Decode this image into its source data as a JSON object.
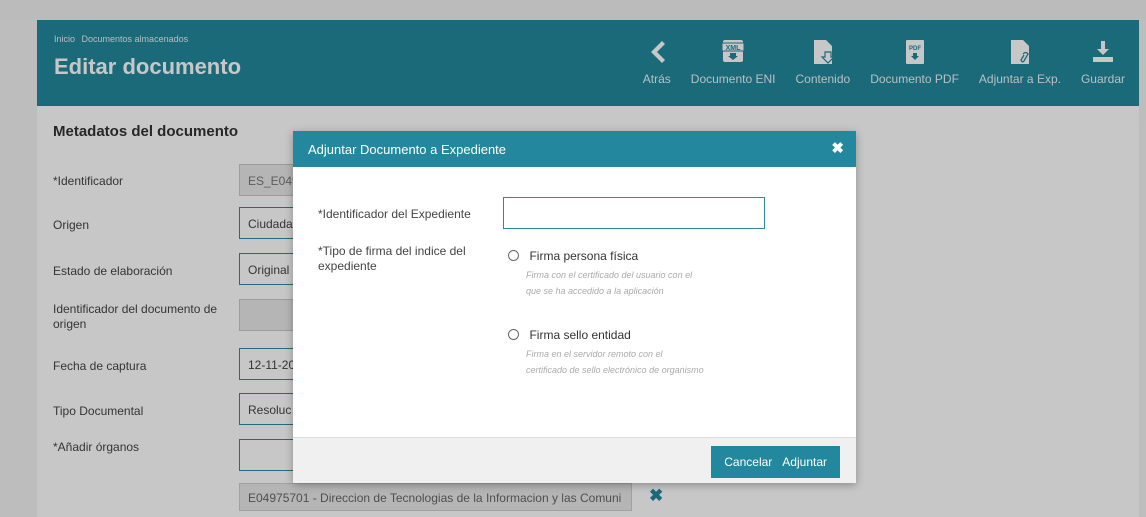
{
  "header": {
    "breadcrumb": [
      "Inicio",
      "Documentos almacenados"
    ],
    "title": "Editar documento",
    "toolbar": [
      {
        "label": "Atrás",
        "icon": "back-arrow-icon"
      },
      {
        "label": "Documento ENI",
        "icon": "xml-download-icon"
      },
      {
        "label": "Contenido",
        "icon": "document-download-icon"
      },
      {
        "label": "Documento PDF",
        "icon": "pdf-download-icon"
      },
      {
        "label": "Adjuntar a Exp.",
        "icon": "attach-document-icon"
      },
      {
        "label": "Guardar",
        "icon": "save-icon"
      }
    ]
  },
  "form": {
    "section_title": "Metadatos del documento",
    "fields": [
      {
        "label": "*Identificador",
        "value": "ES_E049"
      },
      {
        "label": "Origen",
        "value": "Ciudada"
      },
      {
        "label": "Estado de elaboración",
        "value": "Original"
      },
      {
        "label": "Identificador del documento de origen",
        "value": ""
      },
      {
        "label": "Fecha de captura",
        "value": "12-11-20"
      },
      {
        "label": "Tipo Documental",
        "value": "Resoluc"
      },
      {
        "label": "*Añadir órganos",
        "value": ""
      }
    ],
    "organ_value": "E04975701 - Direccion de Tecnologias de la Informacion y las Comuni"
  },
  "modal": {
    "title": "Adjuntar Documento a Expediente",
    "expediente_label": "*Identificador del Expediente",
    "expediente_value": "",
    "firma_label": "*Tipo de firma del indice del expediente",
    "options": [
      {
        "label": "Firma persona física",
        "desc": "Firma con el certificado del usuario con el que se ha accedido a la aplicación",
        "selected": false
      },
      {
        "label": "Firma sello entidad",
        "desc": "Firma en el servidor remoto con el certificado de sello electrónico de organismo",
        "selected": false
      }
    ],
    "cancel_label": "Cancelar",
    "submit_label": "Adjuntar"
  },
  "colors": {
    "accent": "#23889d",
    "header_text": "#ffffff"
  }
}
